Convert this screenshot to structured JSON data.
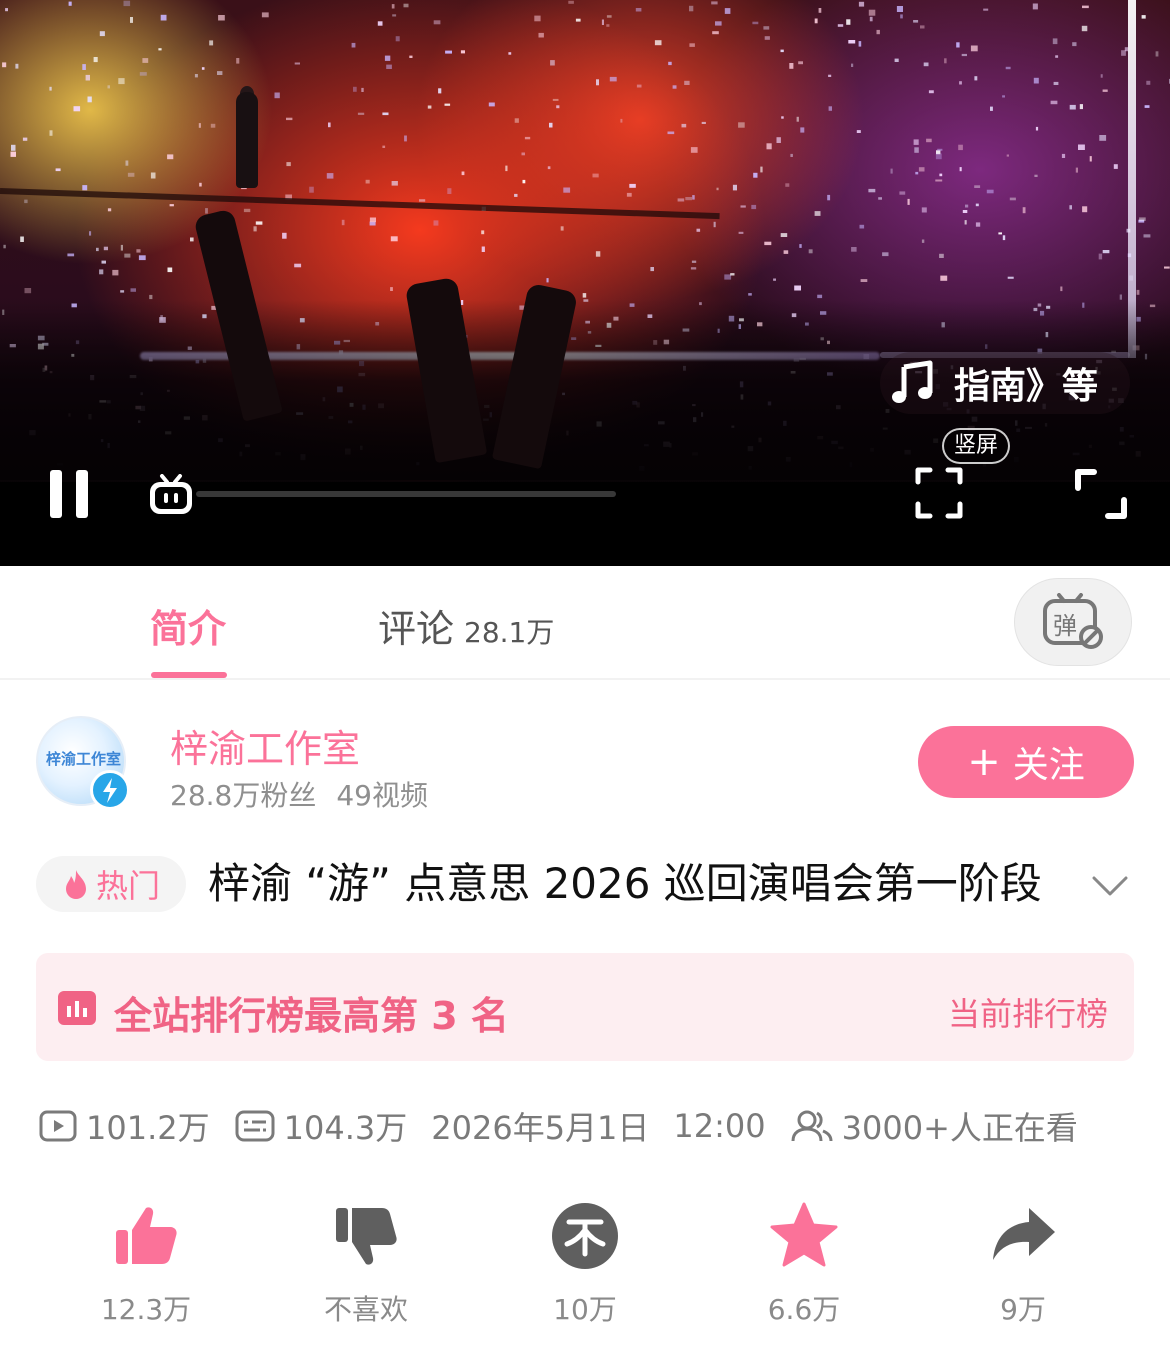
{
  "player": {
    "music_label": "指南》等",
    "vertical_label": "竖屏"
  },
  "tabs": {
    "intro_label": "简介",
    "comments_label": "评论",
    "comments_count": "28.1万"
  },
  "uploader": {
    "name": "梓渝工作室",
    "avatar_text": "梓渝工作室",
    "fans": "28.8万粉丝",
    "videos": "49视频",
    "follow_label": "关注"
  },
  "video": {
    "hot_label": "热门",
    "title": "梓渝 “游” 点意思 2026 巡回演唱会第一阶段"
  },
  "ranking": {
    "text": "全站排行榜最高第 3 名",
    "link": "当前排行榜"
  },
  "meta": {
    "plays": "101.2万",
    "danmaku": "104.3万",
    "date": "2026年5月1日",
    "time": "12:00",
    "watching": "3000+人正在看"
  },
  "actions": {
    "like": "12.3万",
    "dislike": "不喜欢",
    "coin": "10万",
    "favorite": "6.6万",
    "share": "9万"
  },
  "colors": {
    "brand_pink": "#fb7299",
    "ranking_bg": "#fdeef1",
    "ranking_text": "#f06385",
    "icon_gray": "#5f5f5f"
  },
  "icons": [
    "pause-icon",
    "tv-icon",
    "music-note-icon",
    "vertical-screen-icon",
    "fullscreen-icon",
    "danmaku-toggle-icon",
    "verified-icon",
    "flame-icon",
    "chevron-down-icon",
    "chart-icon",
    "play-count-icon",
    "danmaku-count-icon",
    "viewers-icon",
    "like-icon",
    "dislike-icon",
    "coin-icon",
    "star-icon",
    "share-icon"
  ]
}
